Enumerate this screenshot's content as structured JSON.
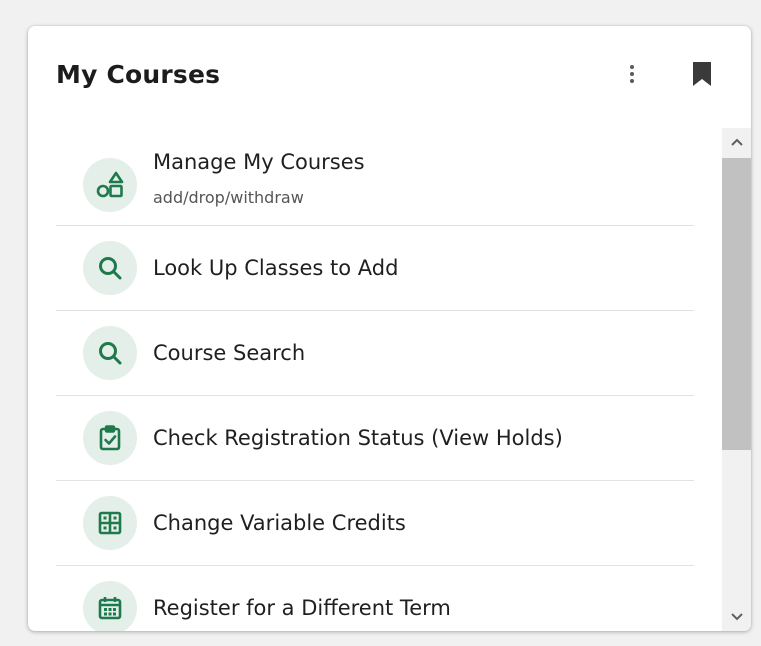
{
  "card": {
    "title": "My Courses",
    "more_icon": "more-vertical-icon",
    "bookmark_icon": "bookmark-icon"
  },
  "items": [
    {
      "label": "Manage My Courses",
      "sublabel": "add/drop/withdraw",
      "icon": "shapes-icon"
    },
    {
      "label": "Look Up Classes to Add",
      "icon": "search-icon"
    },
    {
      "label": "Course Search",
      "icon": "search-icon"
    },
    {
      "label": "Check Registration Status (View Holds)",
      "icon": "clipboard-check-icon"
    },
    {
      "label": "Change Variable Credits",
      "icon": "grid-icon"
    },
    {
      "label": "Register for a Different Term",
      "icon": "calendar-icon"
    }
  ],
  "colors": {
    "accent": "#1e7a4c",
    "icon_background": "#e3efe8",
    "card_background": "#ffffff",
    "page_background": "#f1f1f1"
  }
}
